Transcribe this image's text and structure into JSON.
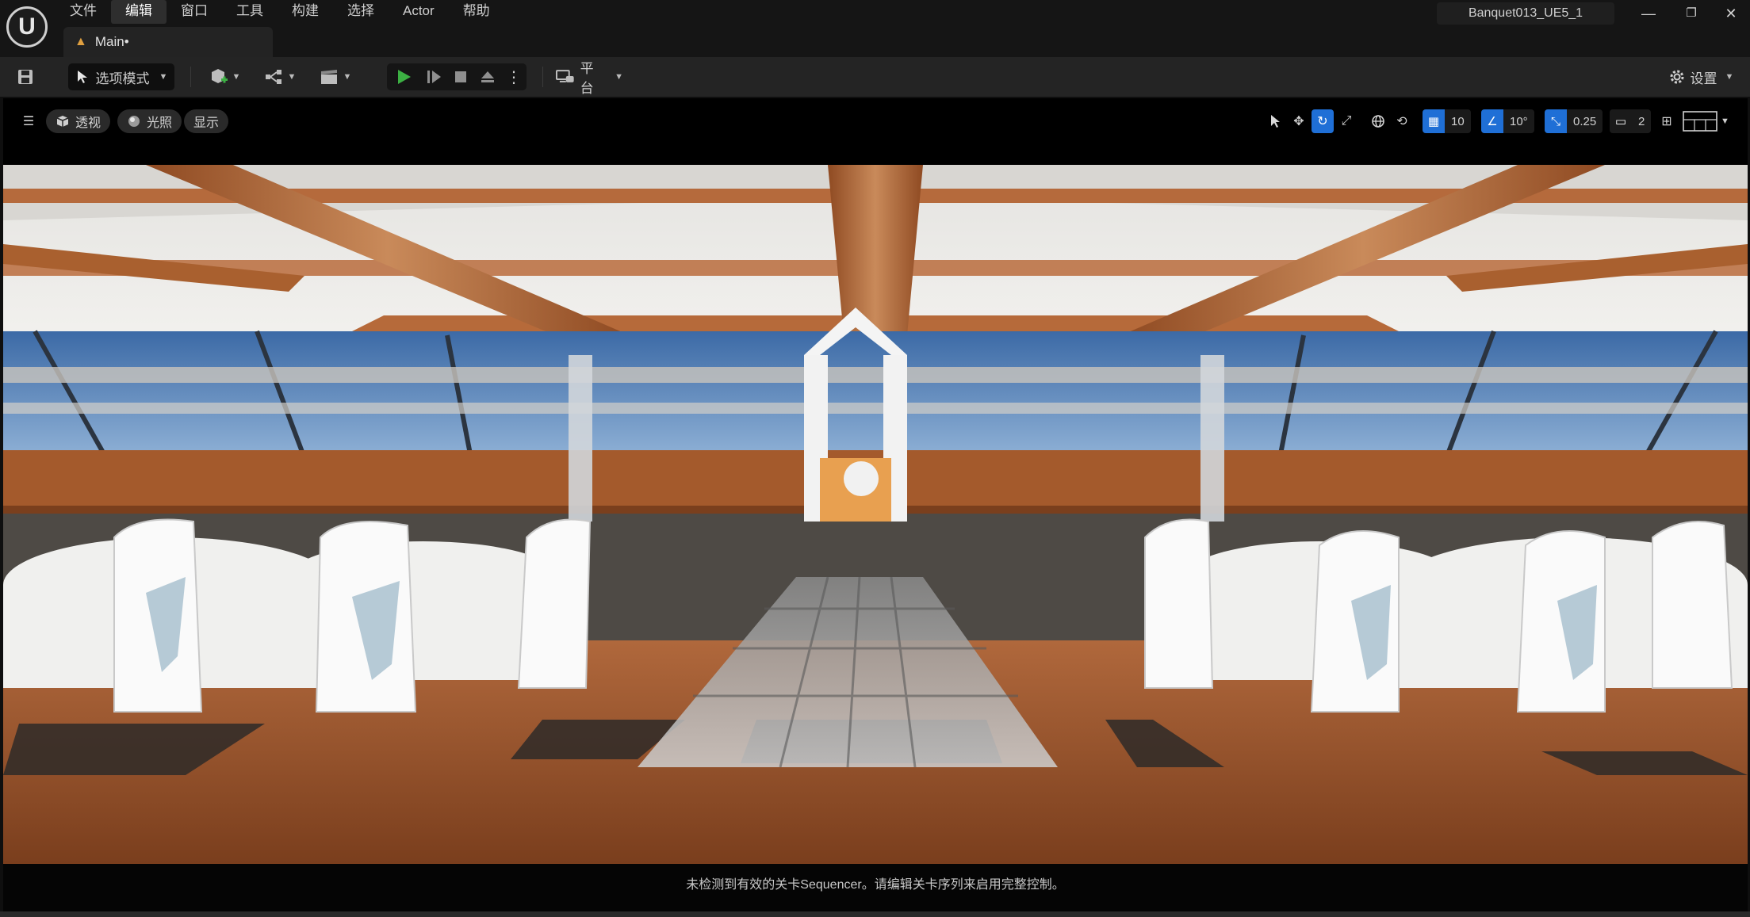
{
  "menu": {
    "items": [
      "文件",
      "编辑",
      "窗口",
      "工具",
      "构建",
      "选择",
      "Actor",
      "帮助"
    ],
    "active_index": 1
  },
  "window": {
    "project_name": "Banquet013_UE5_1",
    "minimize": "—",
    "restore": "❐",
    "close": "✕"
  },
  "tabs": {
    "main_label": "Main•"
  },
  "toolbar": {
    "mode_label": "选项模式",
    "platform_label": "平台",
    "settings_label": "设置"
  },
  "viewport_toolbar": {
    "perspective_label": "透视",
    "lighting_label": "光照",
    "show_label": "显示",
    "grid_snap_value": "10",
    "rotation_snap_value": "10°",
    "scale_snap_value": "0.25",
    "camera_speed_value": "2"
  },
  "viewport": {
    "status_message": "未检测到有效的关卡Sequencer。请编辑关卡序列来启用完整控制。"
  },
  "colors": {
    "accent_blue": "#1f6fd6",
    "play_green": "#3cb043",
    "wood": "#b8683a"
  }
}
